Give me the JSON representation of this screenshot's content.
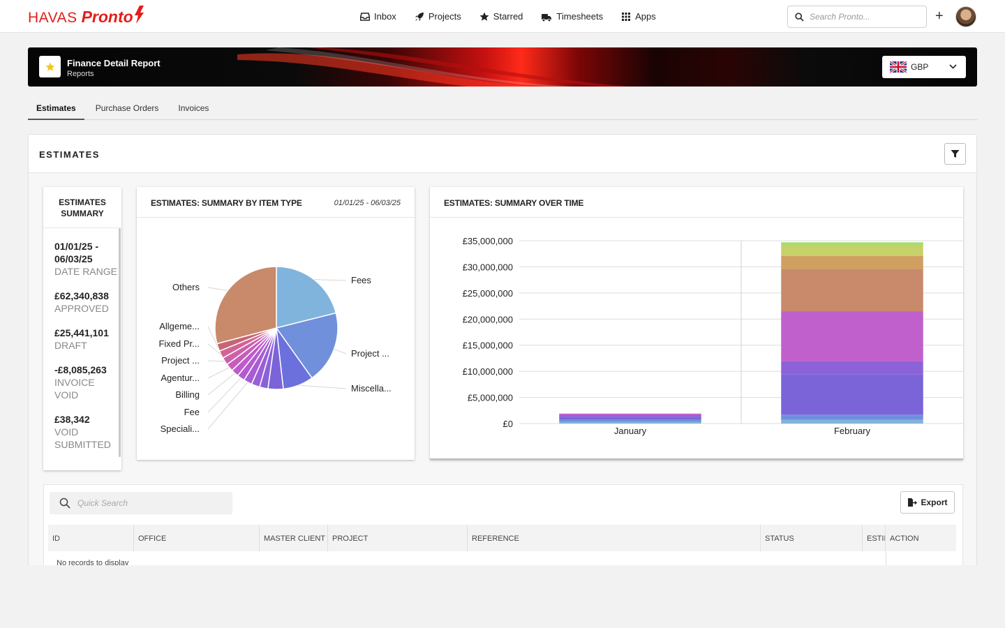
{
  "nav": {
    "brand_main": "HAVAS",
    "brand_product": "Pronto",
    "links": [
      {
        "label": "Inbox",
        "icon": "inbox-icon"
      },
      {
        "label": "Projects",
        "icon": "rocket-icon"
      },
      {
        "label": "Starred",
        "icon": "star-icon"
      },
      {
        "label": "Timesheets",
        "icon": "timesheet-icon"
      },
      {
        "label": "Apps",
        "icon": "apps-grid-icon"
      }
    ],
    "search_placeholder": "Search Pronto..."
  },
  "banner": {
    "title": "Finance Detail Report",
    "subtitle": "Reports",
    "currency": "GBP"
  },
  "tabs": [
    {
      "label": "Estimates",
      "active": true
    },
    {
      "label": "Purchase Orders",
      "active": false
    },
    {
      "label": "Invoices",
      "active": false
    }
  ],
  "section_title": "ESTIMATES",
  "summary": {
    "title": "ESTIMATES SUMMARY",
    "items": [
      {
        "value": "01/01/25 - 06/03/25",
        "label": "DATE RANGE"
      },
      {
        "value": "£62,340,838",
        "label": "APPROVED"
      },
      {
        "value": "£25,441,101",
        "label": "DRAFT"
      },
      {
        "value": "-£8,085,263",
        "label": "INVOICE VOID"
      },
      {
        "value": "£38,342",
        "label": "VOID SUBMITTED"
      }
    ]
  },
  "pie_panel": {
    "title": "ESTIMATES: SUMMARY BY ITEM TYPE",
    "date_range": "01/01/25 - 06/03/25"
  },
  "time_panel": {
    "title": "ESTIMATES: SUMMARY OVER TIME"
  },
  "table": {
    "quick_search_placeholder": "Quick Search",
    "export_label": "Export",
    "columns": [
      "ID",
      "OFFICE",
      "MASTER CLIENT",
      "PROJECT",
      "REFERENCE",
      "STATUS",
      "ESTIMATE",
      "ACTION"
    ],
    "empty_text": "No records to display"
  },
  "colors": {
    "brand_red": "#e31d1a",
    "star_yellow": "#f3c623"
  },
  "chart_data": [
    {
      "type": "pie",
      "title": "ESTIMATES: SUMMARY BY ITEM TYPE",
      "slices": [
        {
          "label": "Fees",
          "value": 21,
          "color": "#80b4dc"
        },
        {
          "label": "Project ...",
          "value": 19,
          "color": "#7090dc"
        },
        {
          "label": "Miscella...",
          "value": 8,
          "color": "#6c70dc"
        },
        {
          "label": "",
          "value": 4,
          "color": "#7a64d8"
        },
        {
          "label": "",
          "value": 2.2,
          "color": "#8a62d8"
        },
        {
          "label": "",
          "value": 2.2,
          "color": "#9a5ed6"
        },
        {
          "label": "Speciali...",
          "value": 2.2,
          "color": "#a85cd4"
        },
        {
          "label": "Fee",
          "value": 2.0,
          "color": "#b45ad0"
        },
        {
          "label": "Billing",
          "value": 2.0,
          "color": "#c05acc"
        },
        {
          "label": "Agentur...",
          "value": 2.0,
          "color": "#c65cbc"
        },
        {
          "label": "Project ...",
          "value": 2.0,
          "color": "#cc60aa"
        },
        {
          "label": "Fixed Pr...",
          "value": 2.0,
          "color": "#d06494"
        },
        {
          "label": "Allgeme...",
          "value": 2.0,
          "color": "#c86474"
        },
        {
          "label": "Others",
          "value": 29,
          "color": "#c88a6a"
        }
      ]
    },
    {
      "type": "bar",
      "stacked": true,
      "title": "ESTIMATES: SUMMARY OVER TIME",
      "categories": [
        "January",
        "February"
      ],
      "ylim": [
        0,
        35000000
      ],
      "yticks": [
        "£0",
        "£5,000,000",
        "£10,000,000",
        "£15,000,000",
        "£20,000,000",
        "£25,000,000",
        "£30,000,000",
        "£35,000,000"
      ],
      "ytick_values": [
        0,
        5000000,
        10000000,
        15000000,
        20000000,
        25000000,
        30000000,
        35000000
      ],
      "series": [
        {
          "color": "#80b4dc",
          "values": [
            300000,
            700000
          ]
        },
        {
          "color": "#7090dc",
          "values": [
            500000,
            1000000
          ]
        },
        {
          "color": "#7a64d8",
          "values": [
            500000,
            7700000
          ]
        },
        {
          "color": "#8c62d8",
          "values": [
            300000,
            2500000
          ]
        },
        {
          "color": "#c060cc",
          "values": [
            300000,
            9600000
          ]
        },
        {
          "color": "#c88a6a",
          "values": [
            0,
            8100000
          ]
        },
        {
          "color": "#d0a060",
          "values": [
            0,
            2500000
          ]
        },
        {
          "color": "#c8d06a",
          "values": [
            0,
            1900000
          ]
        },
        {
          "color": "#a8dc70",
          "values": [
            0,
            700000
          ]
        }
      ]
    }
  ]
}
